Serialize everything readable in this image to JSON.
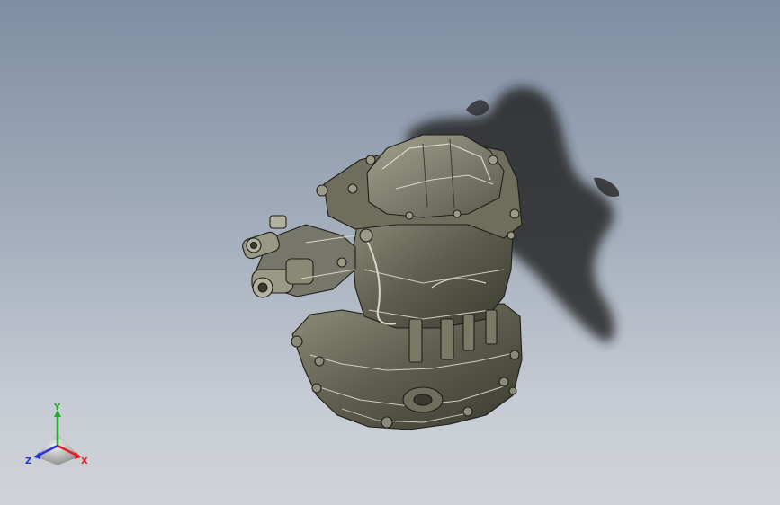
{
  "viewport": {
    "background_top": "#7f8ea3",
    "background_bottom": "#d0d3d8",
    "model_color": "#5c5c4c",
    "shadow_color": "#2a2a2a"
  },
  "triad": {
    "x_label": "X",
    "y_label": "Y",
    "z_label": "Z",
    "x_color": "#e0201c",
    "y_color": "#1fae2a",
    "z_color": "#2436d8"
  }
}
